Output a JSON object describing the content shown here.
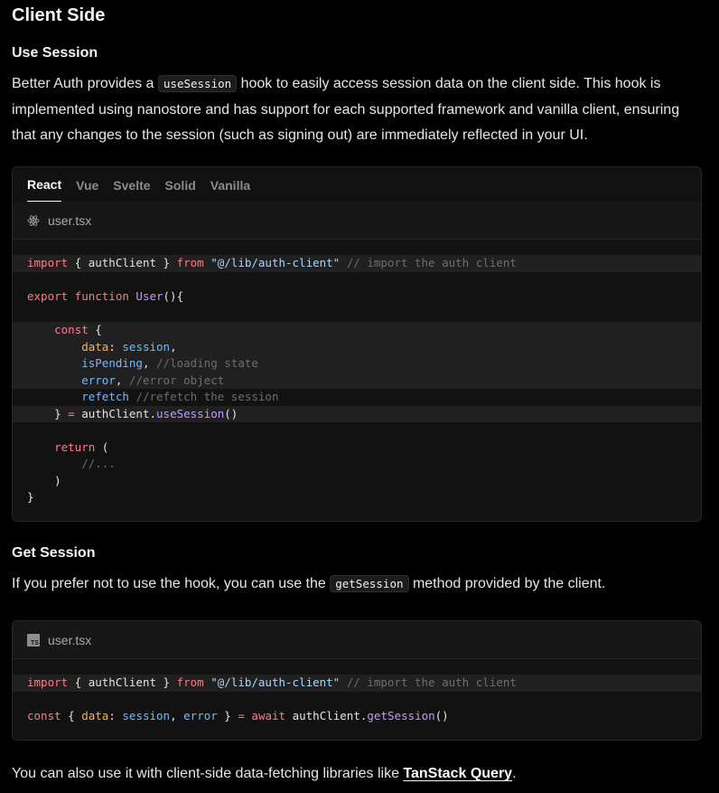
{
  "section_title": "Client Side",
  "use_session": {
    "title": "Use Session",
    "intro_before": "Better Auth provides a",
    "intro_code": "useSession",
    "intro_after": "hook to easily access session data on the client side. This hook is implemented using nanostore and has support for each supported framework and vanilla client, ensuring that any changes to the session (such as signing out) are immediately reflected in your UI.",
    "tabs": [
      "React",
      "Vue",
      "Svelte",
      "Solid",
      "Vanilla"
    ],
    "active_tab": "React",
    "filename": "user.tsx",
    "code": {
      "import_kw": "import",
      "import_body": " { authClient } ",
      "from_kw": "from",
      "import_path": "\"@/lib/auth-client\"",
      "import_comment": " // import the auth client",
      "export_kw": "export function",
      "fn_name": "User",
      "fn_tail": "(){",
      "const_kw": "const",
      "brace_open": " {",
      "data_key": "data",
      "session_var": "session",
      "pending_var": "isPending",
      "pending_comment": "//loading state",
      "error_var": "error",
      "error_comment": "//error object",
      "refetch_var": "refetch",
      "refetch_comment": "//refetch the session",
      "close_brace": "}",
      "equals": " = ",
      "client": "authClient.",
      "use_session_fn": "useSession",
      "call": "()",
      "return_kw": "return",
      "return_paren": " (",
      "ellipsis_comment": "//...",
      "close_paren": ")",
      "final_brace": "}"
    }
  },
  "get_session": {
    "title": "Get Session",
    "intro_before": "If you prefer not to use the hook, you can use the",
    "intro_code": "getSession",
    "intro_after": "method provided by the client.",
    "filename": "user.tsx",
    "code": {
      "const_kw": "const",
      "await_kw": "await",
      "get_session_fn": "getSession"
    }
  },
  "footer": {
    "text_before": "You can also use it with client-side data-fetching libraries like",
    "link": "TanStack Query",
    "text_after": "."
  }
}
